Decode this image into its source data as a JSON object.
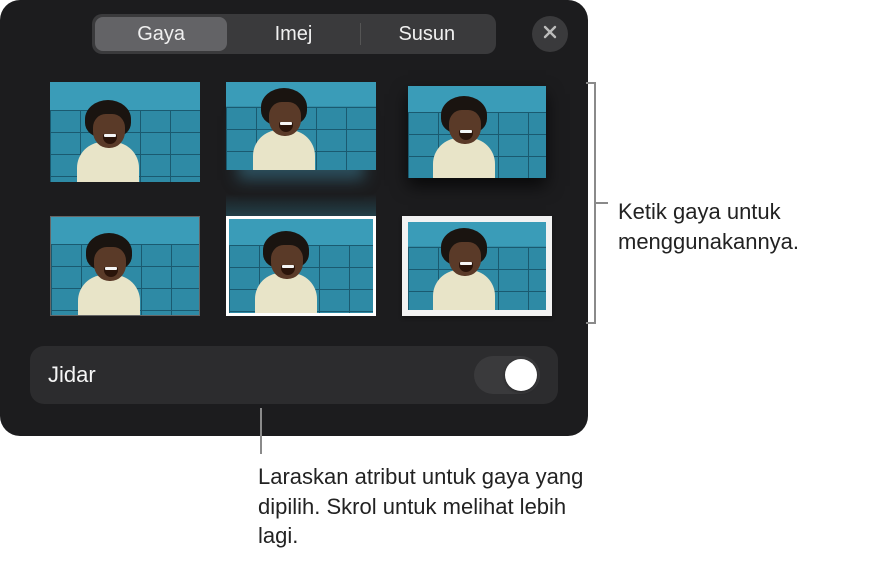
{
  "tabs": {
    "style": "Gaya",
    "image": "Imej",
    "arrange": "Susun"
  },
  "attribute": {
    "border_label": "Jidar"
  },
  "callouts": {
    "tap_style": "Ketik gaya untuk menggunakannya.",
    "adjust_attributes": "Laraskan atribut untuk gaya yang dipilih. Skrol untuk melihat lebih lagi."
  },
  "styles": [
    {
      "id": "plain"
    },
    {
      "id": "reflection"
    },
    {
      "id": "shadow"
    },
    {
      "id": "thin-border"
    },
    {
      "id": "white-border"
    },
    {
      "id": "thick-frame"
    }
  ]
}
